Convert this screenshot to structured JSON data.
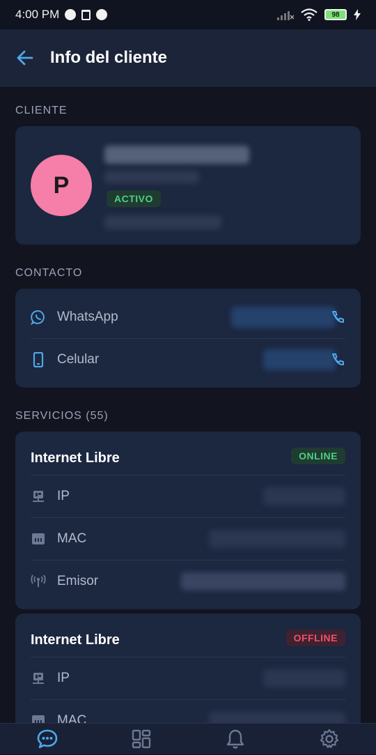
{
  "status_bar": {
    "time": "4:00 PM",
    "battery": "98"
  },
  "header": {
    "title": "Info del cliente"
  },
  "client": {
    "section_label": "CLIENTE",
    "avatar_letter": "P",
    "status_badge": "ACTIVO"
  },
  "contact": {
    "section_label": "CONTACTO",
    "items": [
      {
        "label": "WhatsApp",
        "icon": "whatsapp-icon"
      },
      {
        "label": "Celular",
        "icon": "mobile-phone-icon"
      }
    ]
  },
  "services": {
    "section_label": "SERVICIOS (55)",
    "cards": [
      {
        "title": "Internet Libre",
        "status": "ONLINE",
        "rows": [
          {
            "label": "IP",
            "icon": "ip-icon"
          },
          {
            "label": "MAC",
            "icon": "network-card-icon"
          },
          {
            "label": "Emisor",
            "icon": "antenna-icon"
          }
        ]
      },
      {
        "title": "Internet Libre",
        "status": "OFFLINE",
        "rows": [
          {
            "label": "IP",
            "icon": "ip-icon"
          },
          {
            "label": "MAC",
            "icon": "network-card-icon"
          }
        ]
      }
    ]
  },
  "colors": {
    "accent": "#4fa8e8",
    "online": "#4ed07f",
    "offline": "#f0506a",
    "avatar": "#f57fa8"
  },
  "nav": {
    "items": [
      "chat-icon",
      "dashboard-icon",
      "bell-icon",
      "gear-icon"
    ]
  }
}
